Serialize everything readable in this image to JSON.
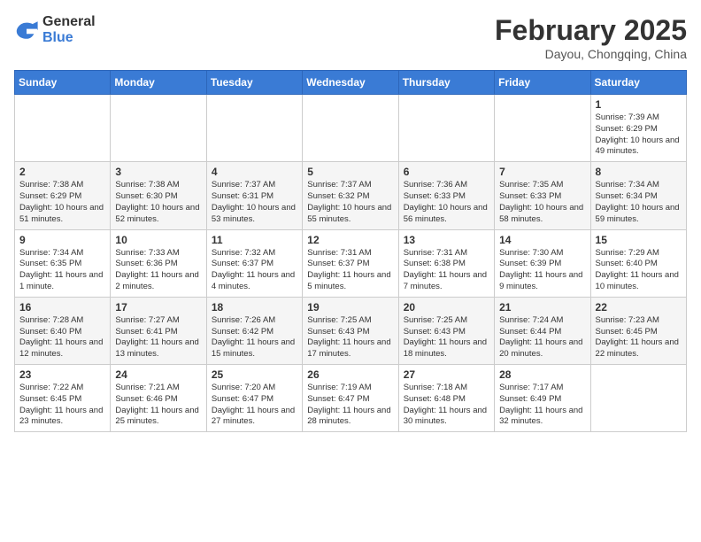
{
  "logo": {
    "general": "General",
    "blue": "Blue"
  },
  "header": {
    "month": "February 2025",
    "location": "Dayou, Chongqing, China"
  },
  "weekdays": [
    "Sunday",
    "Monday",
    "Tuesday",
    "Wednesday",
    "Thursday",
    "Friday",
    "Saturday"
  ],
  "weeks": [
    [
      {
        "day": "",
        "info": ""
      },
      {
        "day": "",
        "info": ""
      },
      {
        "day": "",
        "info": ""
      },
      {
        "day": "",
        "info": ""
      },
      {
        "day": "",
        "info": ""
      },
      {
        "day": "",
        "info": ""
      },
      {
        "day": "1",
        "info": "Sunrise: 7:39 AM\nSunset: 6:29 PM\nDaylight: 10 hours and 49 minutes."
      }
    ],
    [
      {
        "day": "2",
        "info": "Sunrise: 7:38 AM\nSunset: 6:29 PM\nDaylight: 10 hours and 51 minutes."
      },
      {
        "day": "3",
        "info": "Sunrise: 7:38 AM\nSunset: 6:30 PM\nDaylight: 10 hours and 52 minutes."
      },
      {
        "day": "4",
        "info": "Sunrise: 7:37 AM\nSunset: 6:31 PM\nDaylight: 10 hours and 53 minutes."
      },
      {
        "day": "5",
        "info": "Sunrise: 7:37 AM\nSunset: 6:32 PM\nDaylight: 10 hours and 55 minutes."
      },
      {
        "day": "6",
        "info": "Sunrise: 7:36 AM\nSunset: 6:33 PM\nDaylight: 10 hours and 56 minutes."
      },
      {
        "day": "7",
        "info": "Sunrise: 7:35 AM\nSunset: 6:33 PM\nDaylight: 10 hours and 58 minutes."
      },
      {
        "day": "8",
        "info": "Sunrise: 7:34 AM\nSunset: 6:34 PM\nDaylight: 10 hours and 59 minutes."
      }
    ],
    [
      {
        "day": "9",
        "info": "Sunrise: 7:34 AM\nSunset: 6:35 PM\nDaylight: 11 hours and 1 minute."
      },
      {
        "day": "10",
        "info": "Sunrise: 7:33 AM\nSunset: 6:36 PM\nDaylight: 11 hours and 2 minutes."
      },
      {
        "day": "11",
        "info": "Sunrise: 7:32 AM\nSunset: 6:37 PM\nDaylight: 11 hours and 4 minutes."
      },
      {
        "day": "12",
        "info": "Sunrise: 7:31 AM\nSunset: 6:37 PM\nDaylight: 11 hours and 5 minutes."
      },
      {
        "day": "13",
        "info": "Sunrise: 7:31 AM\nSunset: 6:38 PM\nDaylight: 11 hours and 7 minutes."
      },
      {
        "day": "14",
        "info": "Sunrise: 7:30 AM\nSunset: 6:39 PM\nDaylight: 11 hours and 9 minutes."
      },
      {
        "day": "15",
        "info": "Sunrise: 7:29 AM\nSunset: 6:40 PM\nDaylight: 11 hours and 10 minutes."
      }
    ],
    [
      {
        "day": "16",
        "info": "Sunrise: 7:28 AM\nSunset: 6:40 PM\nDaylight: 11 hours and 12 minutes."
      },
      {
        "day": "17",
        "info": "Sunrise: 7:27 AM\nSunset: 6:41 PM\nDaylight: 11 hours and 13 minutes."
      },
      {
        "day": "18",
        "info": "Sunrise: 7:26 AM\nSunset: 6:42 PM\nDaylight: 11 hours and 15 minutes."
      },
      {
        "day": "19",
        "info": "Sunrise: 7:25 AM\nSunset: 6:43 PM\nDaylight: 11 hours and 17 minutes."
      },
      {
        "day": "20",
        "info": "Sunrise: 7:25 AM\nSunset: 6:43 PM\nDaylight: 11 hours and 18 minutes."
      },
      {
        "day": "21",
        "info": "Sunrise: 7:24 AM\nSunset: 6:44 PM\nDaylight: 11 hours and 20 minutes."
      },
      {
        "day": "22",
        "info": "Sunrise: 7:23 AM\nSunset: 6:45 PM\nDaylight: 11 hours and 22 minutes."
      }
    ],
    [
      {
        "day": "23",
        "info": "Sunrise: 7:22 AM\nSunset: 6:45 PM\nDaylight: 11 hours and 23 minutes."
      },
      {
        "day": "24",
        "info": "Sunrise: 7:21 AM\nSunset: 6:46 PM\nDaylight: 11 hours and 25 minutes."
      },
      {
        "day": "25",
        "info": "Sunrise: 7:20 AM\nSunset: 6:47 PM\nDaylight: 11 hours and 27 minutes."
      },
      {
        "day": "26",
        "info": "Sunrise: 7:19 AM\nSunset: 6:47 PM\nDaylight: 11 hours and 28 minutes."
      },
      {
        "day": "27",
        "info": "Sunrise: 7:18 AM\nSunset: 6:48 PM\nDaylight: 11 hours and 30 minutes."
      },
      {
        "day": "28",
        "info": "Sunrise: 7:17 AM\nSunset: 6:49 PM\nDaylight: 11 hours and 32 minutes."
      },
      {
        "day": "",
        "info": ""
      }
    ]
  ]
}
